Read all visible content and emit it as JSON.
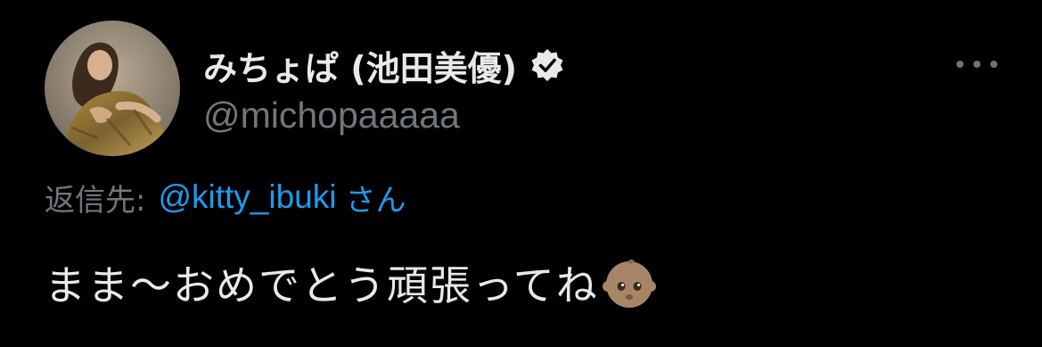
{
  "author": {
    "display_name": "みちょぱ (池田美優)",
    "handle": "@michopaaaaa",
    "verified_icon": "verified-badge-icon",
    "avatar_icon": "profile-photo"
  },
  "more_menu": {
    "icon": "more-horizontal-icon"
  },
  "reply": {
    "prefix": "返信先:",
    "handle": "@kitty_ibuki",
    "suffix": "さん"
  },
  "tweet": {
    "text": "まま〜おめでとう頑張ってね",
    "emoji_icon": "baby-emoji-icon"
  },
  "colors": {
    "background": "#000000",
    "primary_text": "#e7e9ea",
    "secondary_text": "#71767b",
    "link": "#1d9bf0"
  }
}
